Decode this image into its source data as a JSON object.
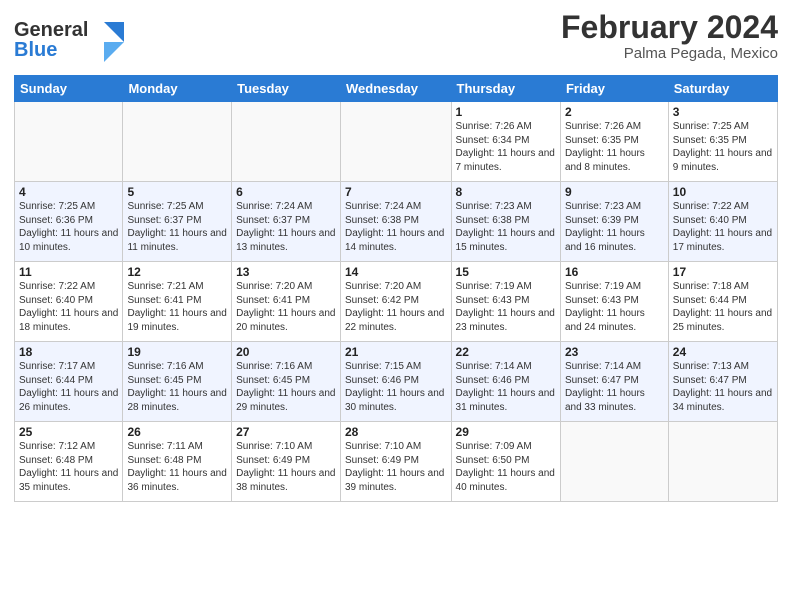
{
  "header": {
    "logo_general": "General",
    "logo_blue": "Blue",
    "title": "February 2024",
    "subtitle": "Palma Pegada, Mexico"
  },
  "days_of_week": [
    "Sunday",
    "Monday",
    "Tuesday",
    "Wednesday",
    "Thursday",
    "Friday",
    "Saturday"
  ],
  "weeks": [
    [
      {
        "day": "",
        "info": ""
      },
      {
        "day": "",
        "info": ""
      },
      {
        "day": "",
        "info": ""
      },
      {
        "day": "",
        "info": ""
      },
      {
        "day": "1",
        "info": "Sunrise: 7:26 AM\nSunset: 6:34 PM\nDaylight: 11 hours and 7 minutes."
      },
      {
        "day": "2",
        "info": "Sunrise: 7:26 AM\nSunset: 6:35 PM\nDaylight: 11 hours and 8 minutes."
      },
      {
        "day": "3",
        "info": "Sunrise: 7:25 AM\nSunset: 6:35 PM\nDaylight: 11 hours and 9 minutes."
      }
    ],
    [
      {
        "day": "4",
        "info": "Sunrise: 7:25 AM\nSunset: 6:36 PM\nDaylight: 11 hours and 10 minutes."
      },
      {
        "day": "5",
        "info": "Sunrise: 7:25 AM\nSunset: 6:37 PM\nDaylight: 11 hours and 11 minutes."
      },
      {
        "day": "6",
        "info": "Sunrise: 7:24 AM\nSunset: 6:37 PM\nDaylight: 11 hours and 13 minutes."
      },
      {
        "day": "7",
        "info": "Sunrise: 7:24 AM\nSunset: 6:38 PM\nDaylight: 11 hours and 14 minutes."
      },
      {
        "day": "8",
        "info": "Sunrise: 7:23 AM\nSunset: 6:38 PM\nDaylight: 11 hours and 15 minutes."
      },
      {
        "day": "9",
        "info": "Sunrise: 7:23 AM\nSunset: 6:39 PM\nDaylight: 11 hours and 16 minutes."
      },
      {
        "day": "10",
        "info": "Sunrise: 7:22 AM\nSunset: 6:40 PM\nDaylight: 11 hours and 17 minutes."
      }
    ],
    [
      {
        "day": "11",
        "info": "Sunrise: 7:22 AM\nSunset: 6:40 PM\nDaylight: 11 hours and 18 minutes."
      },
      {
        "day": "12",
        "info": "Sunrise: 7:21 AM\nSunset: 6:41 PM\nDaylight: 11 hours and 19 minutes."
      },
      {
        "day": "13",
        "info": "Sunrise: 7:20 AM\nSunset: 6:41 PM\nDaylight: 11 hours and 20 minutes."
      },
      {
        "day": "14",
        "info": "Sunrise: 7:20 AM\nSunset: 6:42 PM\nDaylight: 11 hours and 22 minutes."
      },
      {
        "day": "15",
        "info": "Sunrise: 7:19 AM\nSunset: 6:43 PM\nDaylight: 11 hours and 23 minutes."
      },
      {
        "day": "16",
        "info": "Sunrise: 7:19 AM\nSunset: 6:43 PM\nDaylight: 11 hours and 24 minutes."
      },
      {
        "day": "17",
        "info": "Sunrise: 7:18 AM\nSunset: 6:44 PM\nDaylight: 11 hours and 25 minutes."
      }
    ],
    [
      {
        "day": "18",
        "info": "Sunrise: 7:17 AM\nSunset: 6:44 PM\nDaylight: 11 hours and 26 minutes."
      },
      {
        "day": "19",
        "info": "Sunrise: 7:16 AM\nSunset: 6:45 PM\nDaylight: 11 hours and 28 minutes."
      },
      {
        "day": "20",
        "info": "Sunrise: 7:16 AM\nSunset: 6:45 PM\nDaylight: 11 hours and 29 minutes."
      },
      {
        "day": "21",
        "info": "Sunrise: 7:15 AM\nSunset: 6:46 PM\nDaylight: 11 hours and 30 minutes."
      },
      {
        "day": "22",
        "info": "Sunrise: 7:14 AM\nSunset: 6:46 PM\nDaylight: 11 hours and 31 minutes."
      },
      {
        "day": "23",
        "info": "Sunrise: 7:14 AM\nSunset: 6:47 PM\nDaylight: 11 hours and 33 minutes."
      },
      {
        "day": "24",
        "info": "Sunrise: 7:13 AM\nSunset: 6:47 PM\nDaylight: 11 hours and 34 minutes."
      }
    ],
    [
      {
        "day": "25",
        "info": "Sunrise: 7:12 AM\nSunset: 6:48 PM\nDaylight: 11 hours and 35 minutes."
      },
      {
        "day": "26",
        "info": "Sunrise: 7:11 AM\nSunset: 6:48 PM\nDaylight: 11 hours and 36 minutes."
      },
      {
        "day": "27",
        "info": "Sunrise: 7:10 AM\nSunset: 6:49 PM\nDaylight: 11 hours and 38 minutes."
      },
      {
        "day": "28",
        "info": "Sunrise: 7:10 AM\nSunset: 6:49 PM\nDaylight: 11 hours and 39 minutes."
      },
      {
        "day": "29",
        "info": "Sunrise: 7:09 AM\nSunset: 6:50 PM\nDaylight: 11 hours and 40 minutes."
      },
      {
        "day": "",
        "info": ""
      },
      {
        "day": "",
        "info": ""
      }
    ]
  ]
}
